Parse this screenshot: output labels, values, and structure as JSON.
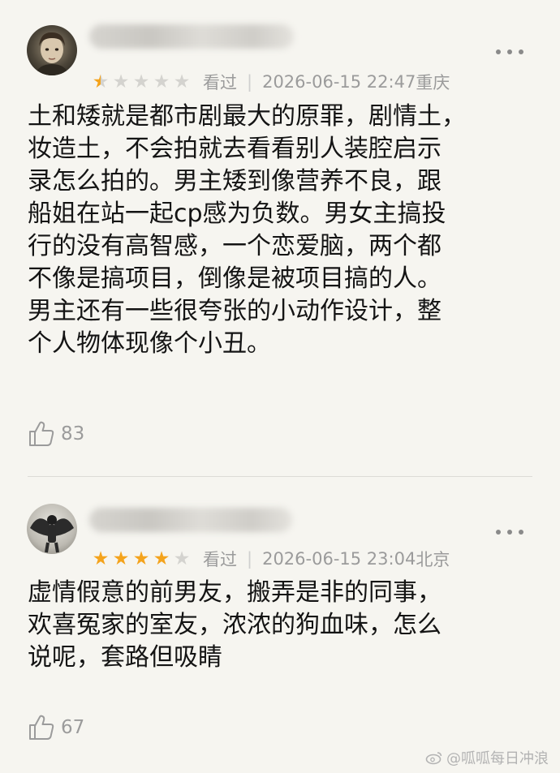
{
  "reviews": [
    {
      "username": "████████████",
      "rating": 1,
      "stars": [
        "★",
        "★",
        "★",
        "★",
        "★"
      ],
      "status": "看过",
      "datetime": "2026-06-15 22:47",
      "location": "重庆",
      "text": "土和矮就是都市剧最大的原罪，剧情土，\n妆造土，不会拍就去看看别人装腔启示\n录怎么拍的。男主矮到像营养不良，跟\n船姐在站一起cp感为负数。男女主搞投\n行的没有高智感，一个恋爱脑，两个都\n不像是搞项目，倒像是被项目搞的人。\n男主还有一些很夸张的小动作设计，整\n个人物体现像个小丑。",
      "likes": "83"
    },
    {
      "username": "████████████",
      "rating": 4,
      "stars": [
        "★",
        "★",
        "★",
        "★",
        "★"
      ],
      "status": "看过",
      "datetime": "2026-06-15 23:04",
      "location": "北京",
      "text": "虚情假意的前男友，搬弄是非的同事，\n欢喜冤家的室友，浓浓的狗血味，怎么\n说呢，套路但吸睛",
      "likes": "67"
    }
  ],
  "separator": "|",
  "watermark": "@呱呱每日冲浪",
  "colors": {
    "star_on": "#f4a31c",
    "star_off": "#d4d3cf",
    "background": "#f6f5f0",
    "meta_text": "#9b9b9b"
  },
  "icons": {
    "like": "thumbs-up-icon",
    "more": "more-dots-icon"
  }
}
